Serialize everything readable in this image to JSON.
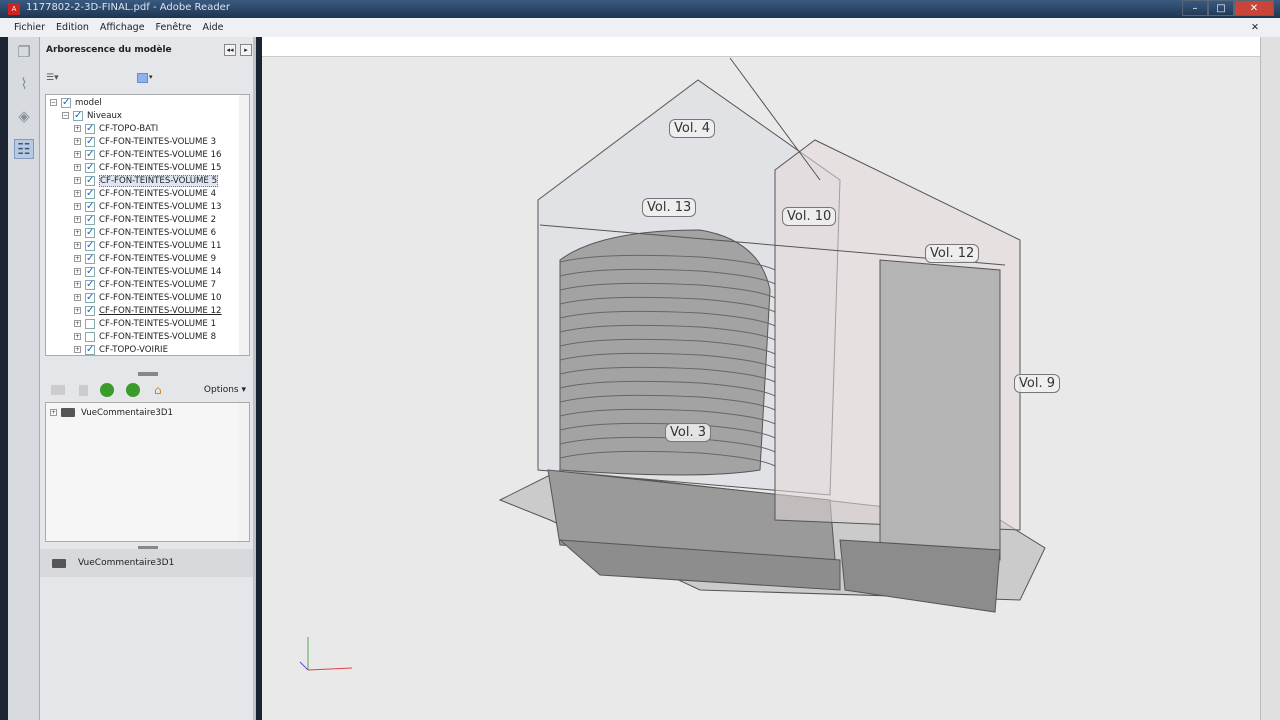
{
  "window": {
    "title": "1177802-2-3D-FINAL.pdf - Adobe Reader"
  },
  "menu": [
    "Fichier",
    "Edition",
    "Affichage",
    "Fenêtre",
    "Aide"
  ],
  "panel": {
    "title": "Arborescence du modèle",
    "options_label": "Options ▾"
  },
  "tree": {
    "root": {
      "label": "model",
      "checked": true
    },
    "group": {
      "label": "Niveaux",
      "checked": true
    },
    "items": [
      {
        "label": "CF-TOPO-BATI",
        "checked": true
      },
      {
        "label": "CF-FON-TEINTES-VOLUME 3",
        "checked": true
      },
      {
        "label": "CF-FON-TEINTES-VOLUME 16",
        "checked": true
      },
      {
        "label": "CF-FON-TEINTES-VOLUME 15",
        "checked": true
      },
      {
        "label": "CF-FON-TEINTES-VOLUME 5",
        "checked": true,
        "selected": true
      },
      {
        "label": "CF-FON-TEINTES-VOLUME 4",
        "checked": true
      },
      {
        "label": "CF-FON-TEINTES-VOLUME 13",
        "checked": true
      },
      {
        "label": "CF-FON-TEINTES-VOLUME 2",
        "checked": true
      },
      {
        "label": "CF-FON-TEINTES-VOLUME 6",
        "checked": true
      },
      {
        "label": "CF-FON-TEINTES-VOLUME 11",
        "checked": true
      },
      {
        "label": "CF-FON-TEINTES-VOLUME 9",
        "checked": true
      },
      {
        "label": "CF-FON-TEINTES-VOLUME 14",
        "checked": true
      },
      {
        "label": "CF-FON-TEINTES-VOLUME 7",
        "checked": true
      },
      {
        "label": "CF-FON-TEINTES-VOLUME 10",
        "checked": true
      },
      {
        "label": "CF-FON-TEINTES-VOLUME 12",
        "checked": true,
        "hover": true
      },
      {
        "label": "CF-FON-TEINTES-VOLUME 1",
        "checked": false
      },
      {
        "label": "CF-FON-TEINTES-VOLUME 8",
        "checked": false
      },
      {
        "label": "CF-TOPO-VOIRIE",
        "checked": true
      }
    ]
  },
  "views": {
    "items": [
      "VueCommentaire3D1"
    ],
    "current": "VueCommentaire3D1"
  },
  "model_labels": {
    "vol4": "Vol. 4",
    "vol13": "Vol. 13",
    "vol10": "Vol. 10",
    "vol12": "Vol. 12",
    "vol9": "Vol. 9",
    "vol3": "Vol. 3"
  }
}
